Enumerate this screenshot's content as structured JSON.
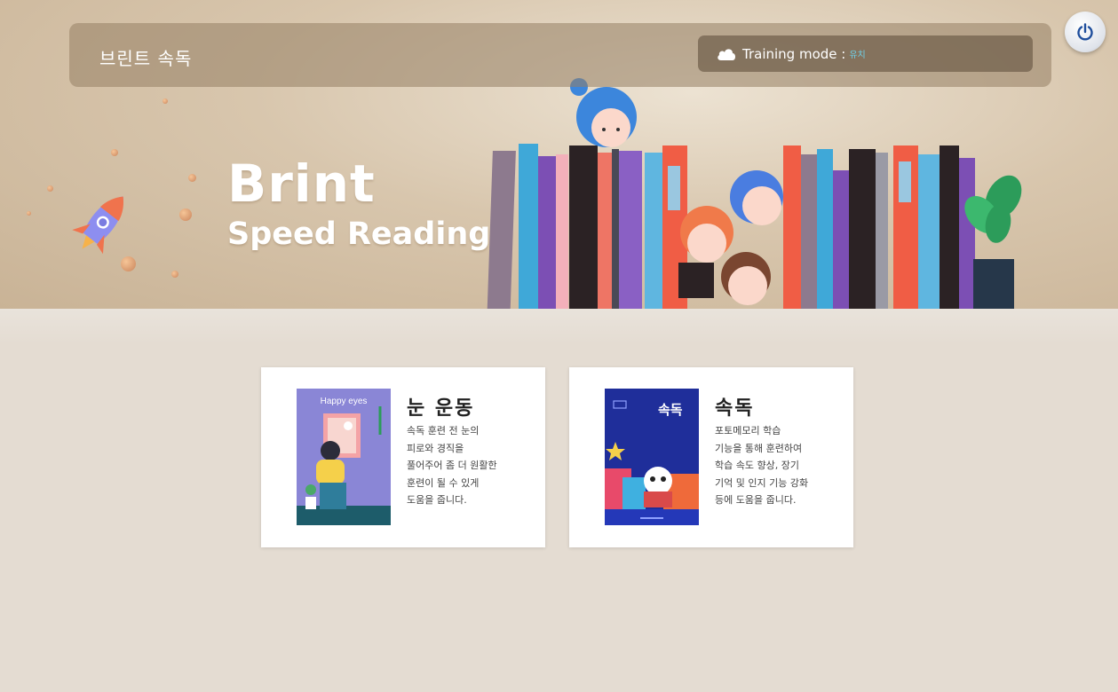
{
  "header": {
    "app_title": "브린트 속독",
    "training_mode_label": "Training mode :",
    "training_mode_value": "유치",
    "power_icon": "power-icon"
  },
  "hero": {
    "brand_line1": "Brint",
    "brand_line2": "Speed Reading"
  },
  "cards": [
    {
      "title": "눈 운동",
      "cover_text": "Happy eyes",
      "description": [
        "속독 훈련 전 눈의",
        "피로와 경직을",
        "풀어주어 좀 더 원활한",
        "훈련이 될 수 있게",
        "도움을 줍니다."
      ]
    },
    {
      "title": "속독",
      "cover_text": "속독",
      "description": [
        "포토메모리 학습",
        "기능을 통해 훈련하여",
        "학습 속도 향상, 장기",
        "기억 및 인지 기능 강화",
        "등에 도움을 줍니다."
      ]
    }
  ],
  "colors": {
    "accent": "#6fd0e8",
    "eye_cover": "#8a86d6",
    "speed_cover": "#1f2e9a"
  }
}
